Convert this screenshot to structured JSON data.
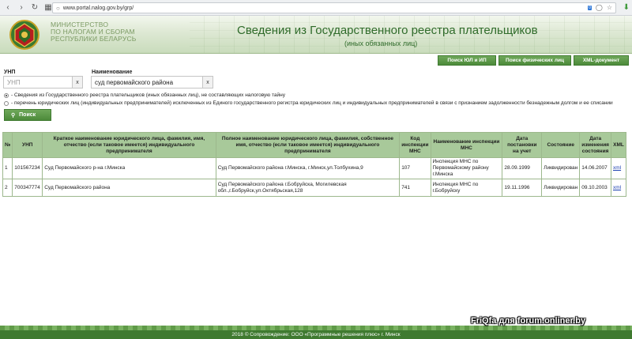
{
  "browser": {
    "url": "www.portal.nalog.gov.by/grp/",
    "ext_badge": "0"
  },
  "header": {
    "org_line1": "Министерство",
    "org_line2": "по налогам и сборам",
    "org_line3": "Республики Беларусь",
    "title_main": "Сведения из Государственного реестра плательщиков",
    "title_sub": "(иных обязанных лиц)"
  },
  "nav": {
    "search_legal": "Поиск ЮЛ и ИП",
    "search_physical": "Поиск физических лиц",
    "xml_doc": "XML-документ"
  },
  "form": {
    "unp_label": "УНП",
    "unp_placeholder": "УНП",
    "name_label": "Наименование",
    "name_value": "суд первомайского района",
    "clear_label": "x",
    "radio1": "- Сведения из Государственного реестра плательщиков (иных обязанных лиц), не составляющих налоговую тайну",
    "radio2": "- перечень юридических лиц (индивидуальных предпринимателей) исключенных из Единого государственного регистра юридических лиц и индивидуальных предпринимателей в связи с признанием задолженности безнадежным долгом и ее списании",
    "search_button": "Поиск"
  },
  "table": {
    "headers": [
      "№",
      "УНП",
      "Краткое наименование юридического лица, фамилия, имя, отчество (если таковое имеется) индивидуального предпринимателя",
      "Полное наименование юридического лица, фамилия, собственное имя, отчество (если таковое имеется) индивидуального предпринимателя",
      "Код инспекции МНС",
      "Наименование инспекции МНС",
      "Дата постановки на учет",
      "Состояние",
      "Дата изменения состояния",
      "XML"
    ],
    "rows": [
      {
        "num": "1",
        "unp": "101567234",
        "short": "Суд Первомайского р-на г.Минска",
        "full": "Суд Первомайского района г.Минска, г.Минск,ул.Толбухина,9",
        "code": "107",
        "inspection": "Инспекция МНС по Первомайскому району г.Минска",
        "reg_date": "28.09.1999",
        "state": "Ликвидирован",
        "change_date": "14.06.2007",
        "xml": "xml"
      },
      {
        "num": "2",
        "unp": "700347774",
        "short": "Суд Первомайского района",
        "full": "Суд Первомайского района г.Бобруйска, Могилевская обл.,г.Бобруйск,ул.Октябрьская,128",
        "code": "741",
        "inspection": "Инспекция МНС по г.Бобруйску",
        "reg_date": "19.11.1996",
        "state": "Ликвидирован",
        "change_date": "09.10.2003",
        "xml": "xml"
      }
    ]
  },
  "footer": {
    "copyright": "2018 © Сопровождение: ООО «Программные решения плюс» г. Минск",
    "watermark": "FriQfa для forum.onliner.by"
  },
  "colors": {
    "accent_green": "#4c8a3a",
    "header_title": "#2f6b2a",
    "table_header": "#a8c99a"
  }
}
